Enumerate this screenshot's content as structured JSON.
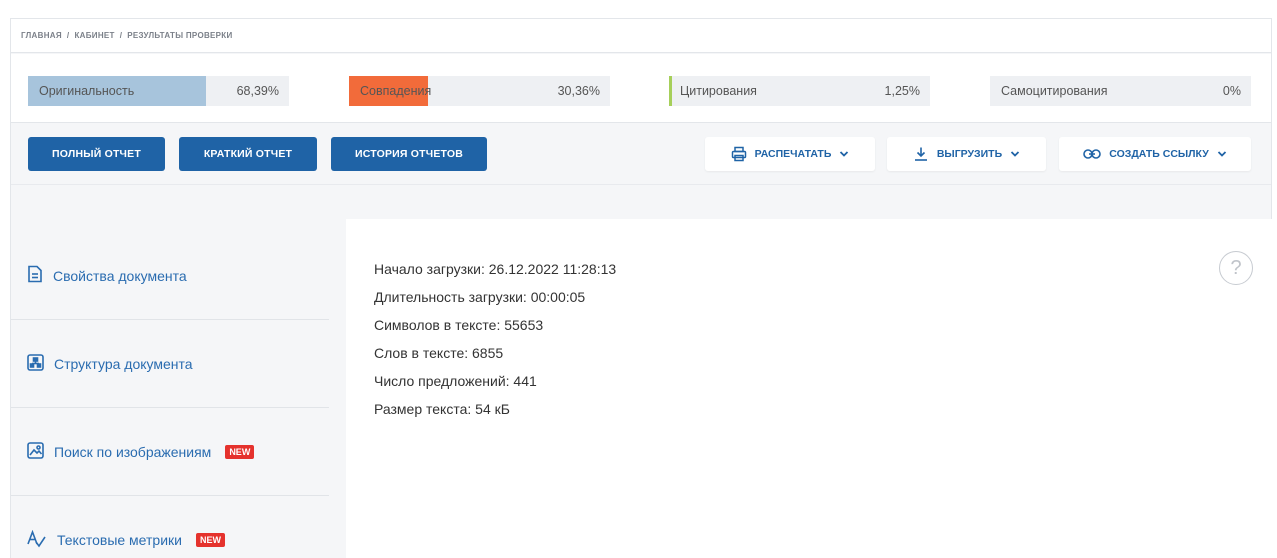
{
  "breadcrumb": [
    "ГЛАВНАЯ",
    "КАБИНЕТ",
    "РЕЗУЛЬТАТЫ ПРОВЕРКИ"
  ],
  "breadcrumb_separator": "/",
  "stats": {
    "originality": {
      "label": "Оригинальность",
      "value": "68,39%",
      "fraction": 0.6839,
      "color": "#a7c4dc"
    },
    "matches": {
      "label": "Совпадения",
      "value": "30,36%",
      "fraction": 0.3036,
      "color": "#f26b3a"
    },
    "citations": {
      "label": "Цитирования",
      "value": "1,25%",
      "fraction": 0.0125,
      "color": "#a6cf5a"
    },
    "self_citations": {
      "label": "Самоцитирования",
      "value": "0%",
      "fraction": 0
    }
  },
  "toolbar": {
    "full_report": "ПОЛНЫЙ ОТЧЕТ",
    "short_report": "КРАТКИЙ ОТЧЕТ",
    "history": "ИСТОРИЯ ОТЧЕТОВ",
    "print": "РАСПЕЧАТАТЬ",
    "export": "ВЫГРУЗИТЬ",
    "create_link": "СОЗДАТЬ ССЫЛКУ"
  },
  "sidebar": {
    "items": [
      {
        "label": "Свойства документа",
        "icon": "document-icon"
      },
      {
        "label": "Структура документа",
        "icon": "structure-icon"
      },
      {
        "label": "Поиск по изображениям",
        "icon": "image-icon",
        "badge": "NEW"
      },
      {
        "label": "Текстовые метрики",
        "icon": "metrics-icon",
        "badge": "NEW"
      }
    ]
  },
  "document_properties": {
    "upload_start": "Начало загрузки: 26.12.2022 11:28:13",
    "upload_duration": "Длительность загрузки: 00:00:05",
    "chars": "Символов в тексте: 55653",
    "words": "Слов в тексте: 6855",
    "sentences": "Число предложений: 441",
    "size": "Размер текста: 54 кБ"
  },
  "help_label": "?",
  "colors": {
    "primary": "#1f63a6",
    "accent_new": "#e5322d",
    "link": "#2a6cb0"
  }
}
